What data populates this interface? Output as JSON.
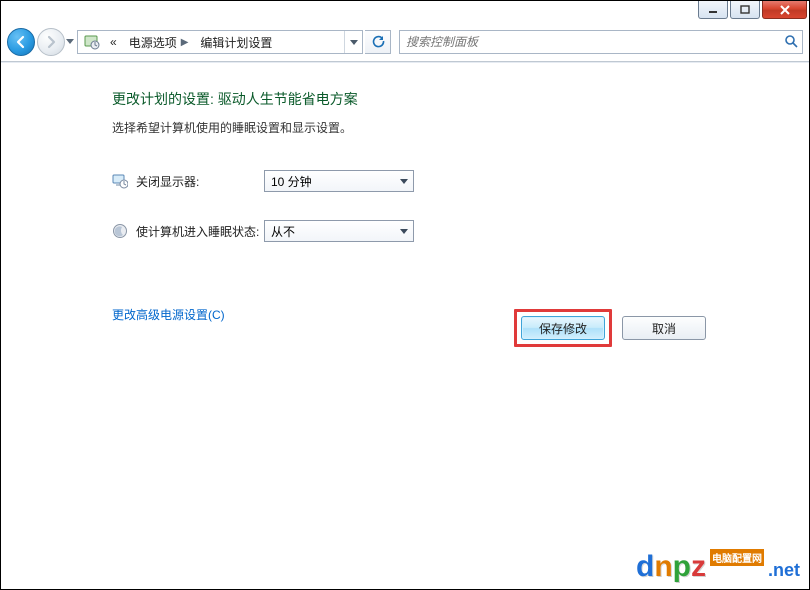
{
  "window_buttons": {
    "minimize": "minimize",
    "maximize": "maximize",
    "close": "close"
  },
  "breadcrumb": {
    "prefix": "«",
    "items": [
      "电源选项",
      "编辑计划设置"
    ]
  },
  "search": {
    "placeholder": "搜索控制面板"
  },
  "page": {
    "title": "更改计划的设置: 驱动人生节能省电方案",
    "subtitle": "选择希望计算机使用的睡眠设置和显示设置。"
  },
  "settings": [
    {
      "icon": "monitor-clock-icon",
      "label": "关闭显示器:",
      "value": "10 分钟"
    },
    {
      "icon": "moon-icon",
      "label": "使计算机进入睡眠状态:",
      "value": "从不"
    }
  ],
  "links": {
    "advanced": "更改高级电源设置(C)"
  },
  "buttons": {
    "save": "保存修改",
    "cancel": "取消"
  },
  "watermark": {
    "letters": [
      "d",
      "n",
      "p",
      "z"
    ],
    "badge": "电脑配置网",
    "suffix": ".net"
  }
}
